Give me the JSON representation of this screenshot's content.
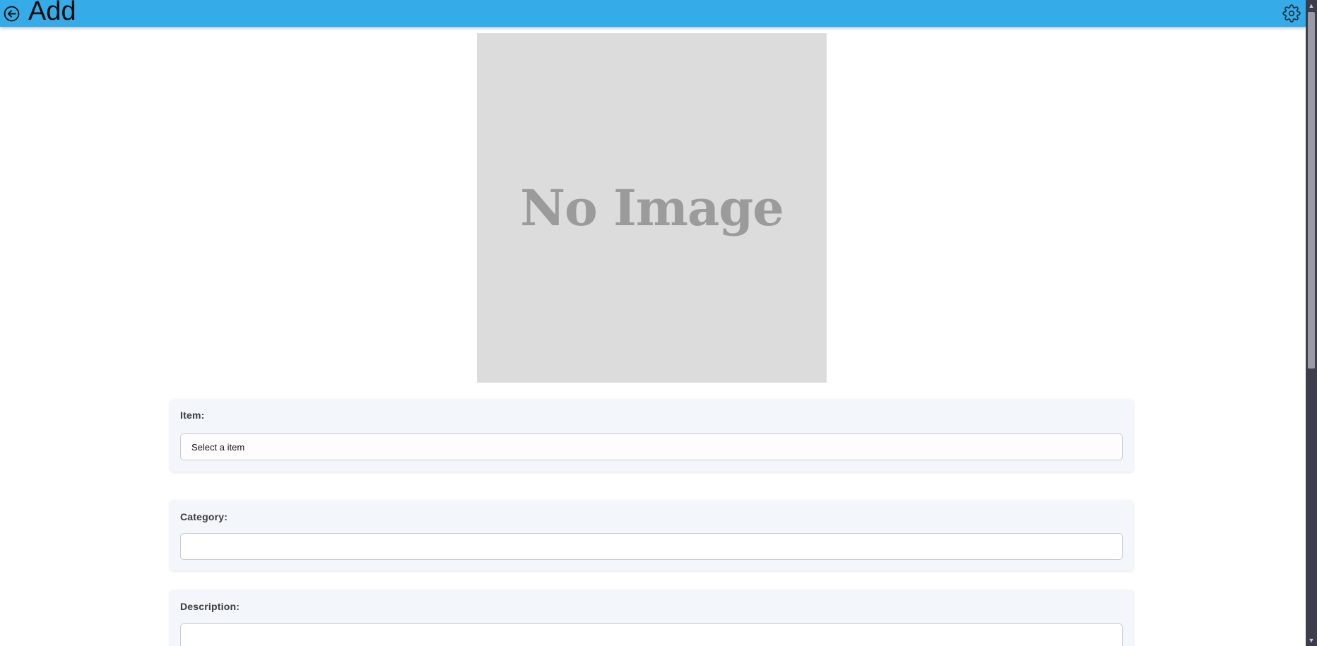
{
  "header": {
    "title": "Add",
    "back_icon": "arrow-left-circle-icon",
    "settings_icon": "gear-icon",
    "background_color": "#35ace8"
  },
  "image": {
    "placeholder_text": "No Image"
  },
  "form": {
    "item": {
      "label": "Item:",
      "selected_value": "Select a item"
    },
    "category": {
      "label": "Category:",
      "value": ""
    },
    "description": {
      "label": "Description:",
      "value": ""
    }
  }
}
